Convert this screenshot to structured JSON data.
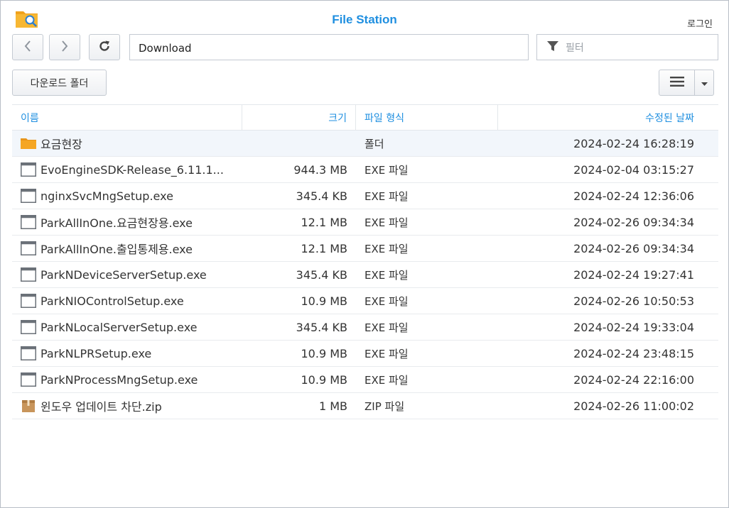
{
  "app": {
    "title": "File Station",
    "login_label": "로그인"
  },
  "nav": {
    "path": "Download",
    "filter_placeholder": "필터"
  },
  "toolbar": {
    "download_folder_label": "다운로드 폴더"
  },
  "columns": {
    "name": "이름",
    "size": "크기",
    "type": "파일 형식",
    "modified": "수정된 날짜"
  },
  "files": [
    {
      "name": "요금현장",
      "size": "",
      "type": "폴더",
      "modified": "2024-02-24 16:28:19",
      "icon": "folder-icon"
    },
    {
      "name": "EvoEngineSDK-Release_6.11.1...",
      "size": "944.3 MB",
      "type": "EXE 파일",
      "modified": "2024-02-04 03:15:27",
      "icon": "exe-file-icon"
    },
    {
      "name": "nginxSvcMngSetup.exe",
      "size": "345.4 KB",
      "type": "EXE 파일",
      "modified": "2024-02-24 12:36:06",
      "icon": "exe-file-icon"
    },
    {
      "name": "ParkAllInOne.요금현장용.exe",
      "size": "12.1 MB",
      "type": "EXE 파일",
      "modified": "2024-02-26 09:34:34",
      "icon": "exe-file-icon"
    },
    {
      "name": "ParkAllInOne.출입통제용.exe",
      "size": "12.1 MB",
      "type": "EXE 파일",
      "modified": "2024-02-26 09:34:34",
      "icon": "exe-file-icon"
    },
    {
      "name": "ParkNDeviceServerSetup.exe",
      "size": "345.4 KB",
      "type": "EXE 파일",
      "modified": "2024-02-24 19:27:41",
      "icon": "exe-file-icon"
    },
    {
      "name": "ParkNIOControlSetup.exe",
      "size": "10.9 MB",
      "type": "EXE 파일",
      "modified": "2024-02-26 10:50:53",
      "icon": "exe-file-icon"
    },
    {
      "name": "ParkNLocalServerSetup.exe",
      "size": "345.4 KB",
      "type": "EXE 파일",
      "modified": "2024-02-24 19:33:04",
      "icon": "exe-file-icon"
    },
    {
      "name": "ParkNLPRSetup.exe",
      "size": "10.9 MB",
      "type": "EXE 파일",
      "modified": "2024-02-24 23:48:15",
      "icon": "exe-file-icon"
    },
    {
      "name": "ParkNProcessMngSetup.exe",
      "size": "10.9 MB",
      "type": "EXE 파일",
      "modified": "2024-02-24 22:16:00",
      "icon": "exe-file-icon"
    },
    {
      "name": "윈도우 업데이트 차단.zip",
      "size": "1 MB",
      "type": "ZIP 파일",
      "modified": "2024-02-26 11:00:02",
      "icon": "zip-file-icon"
    }
  ],
  "colors": {
    "accent": "#1f8fe0",
    "folder": "#f5a623",
    "selected_row": "#f2f6fb"
  }
}
